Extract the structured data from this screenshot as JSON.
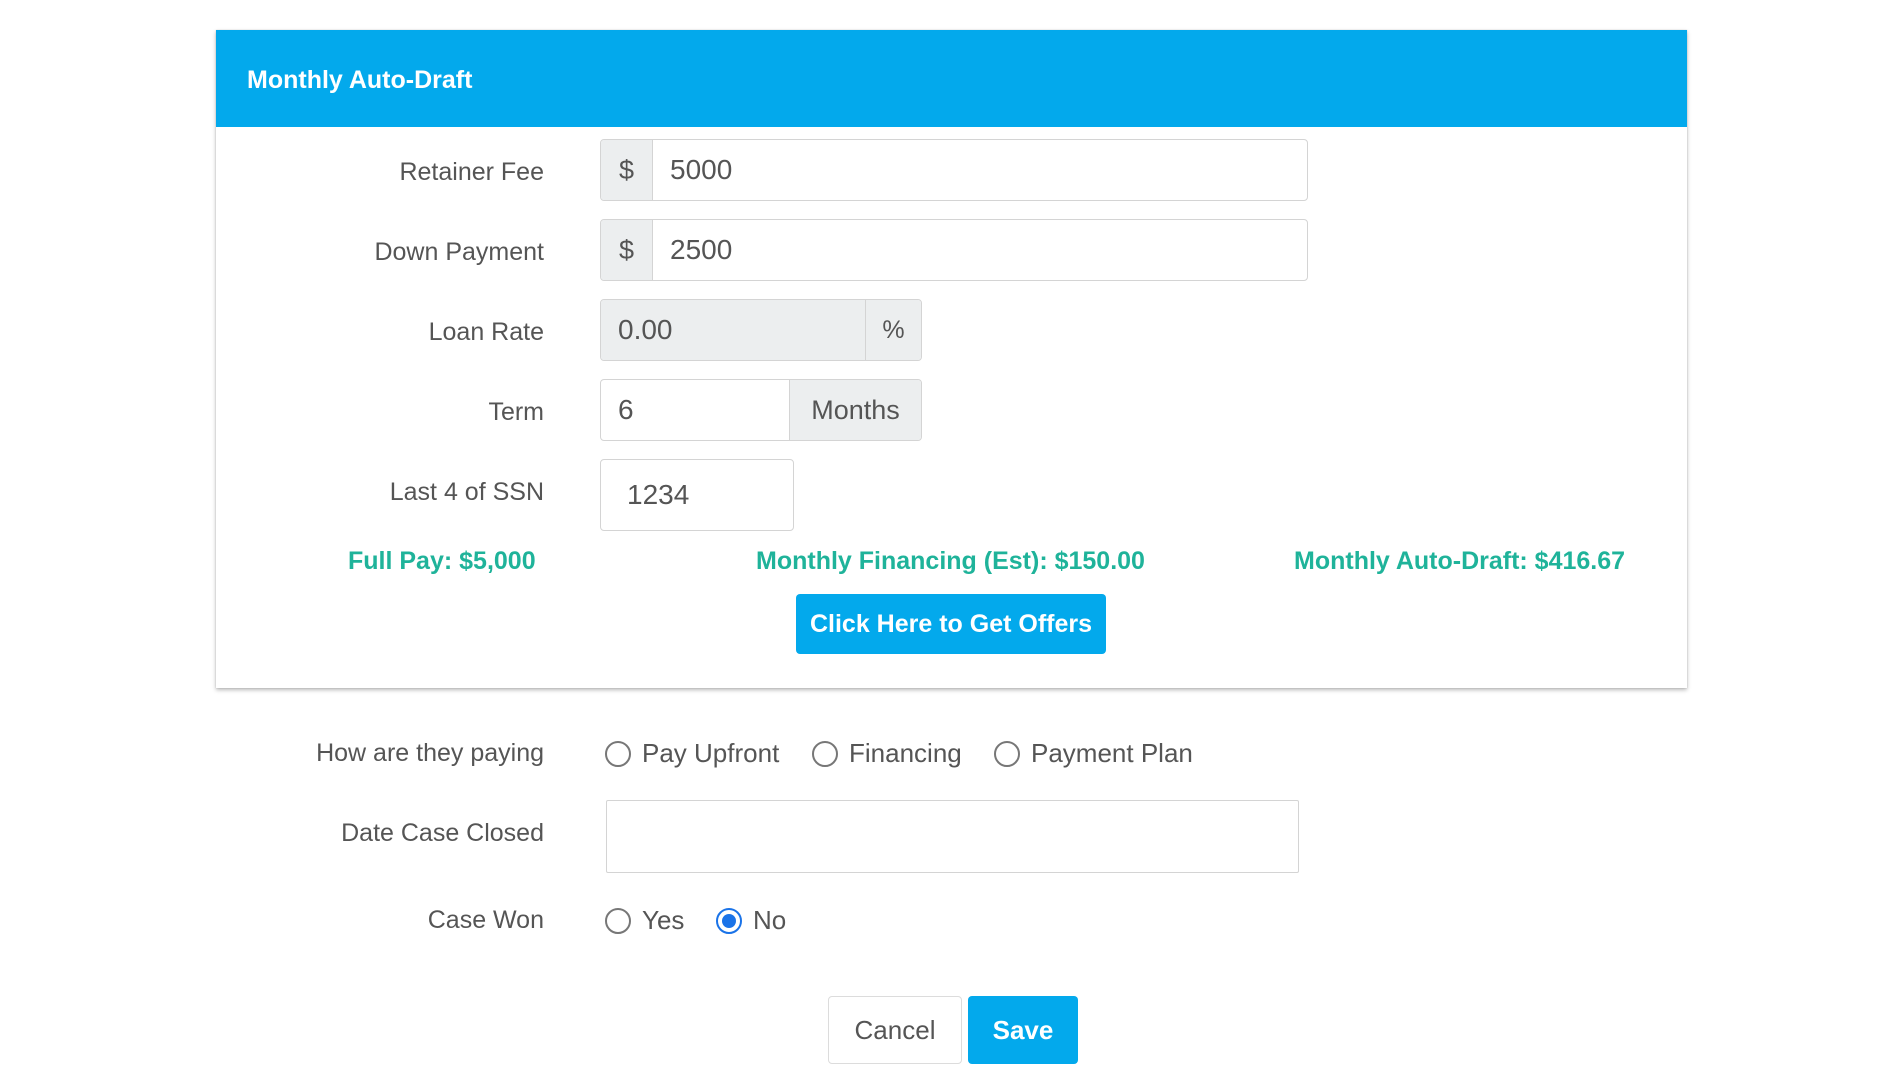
{
  "panel": {
    "title": "Monthly Auto-Draft",
    "fields": {
      "retainer_fee": {
        "label": "Retainer Fee",
        "prefix": "$",
        "value": "5000"
      },
      "down_payment": {
        "label": "Down Payment",
        "prefix": "$",
        "value": "2500"
      },
      "loan_rate": {
        "label": "Loan Rate",
        "value": "0.00",
        "suffix": "%"
      },
      "term": {
        "label": "Term",
        "value": "6",
        "suffix": "Months"
      },
      "ssn_last4": {
        "label": "Last 4 of SSN",
        "value": "1234"
      }
    },
    "summary": {
      "full_pay": "Full Pay: $5,000",
      "monthly_financing": "Monthly Financing (Est): $150.00",
      "monthly_auto_draft": "Monthly Auto-Draft: $416.67"
    },
    "offers_button": "Click Here to Get Offers"
  },
  "form": {
    "paying": {
      "label": "How are they paying",
      "options": [
        "Pay Upfront",
        "Financing",
        "Payment Plan"
      ],
      "selected": null
    },
    "date_closed": {
      "label": "Date Case Closed",
      "value": ""
    },
    "case_won": {
      "label": "Case Won",
      "options": [
        "Yes",
        "No"
      ],
      "selected": "No"
    }
  },
  "actions": {
    "cancel": "Cancel",
    "save": "Save"
  },
  "colors": {
    "header": "#03a9ec",
    "accent": "#03a9ec",
    "summary_text": "#1fb39a",
    "radio_checked": "#1a73e8"
  }
}
